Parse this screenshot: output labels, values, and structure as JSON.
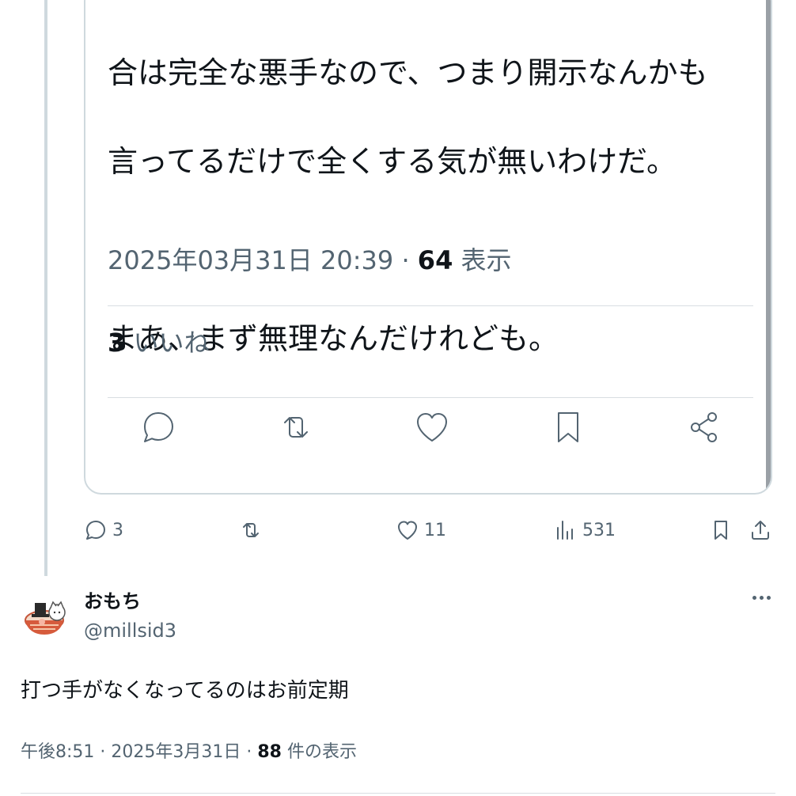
{
  "quoted_tweet": {
    "text_lines": [
      "合は完全な悪手なので、つまり開示なんかも",
      "言ってるだけで全くする気が無いわけだ。",
      "",
      "まあ、まず無理なんだけれども。"
    ],
    "timestamp": "2025年03月31日 20:39 · ",
    "views_count": "64",
    "views_label": " 表示",
    "likes_count": "3",
    "likes_label": " いいね",
    "actions": [
      "reply-icon",
      "retweet-icon",
      "like-icon",
      "bookmark-icon",
      "share-icon"
    ]
  },
  "tweet_actions": {
    "replies": "3",
    "retweets": "",
    "likes": "11",
    "views": "531"
  },
  "reply": {
    "display_name": "おもち",
    "handle": "@millsid3",
    "text": "打つ手がなくなってるのはお前定期",
    "time": "午後8:51 · 2025年3月31日 · ",
    "views_count": "88",
    "views_label": " 件の表示"
  }
}
